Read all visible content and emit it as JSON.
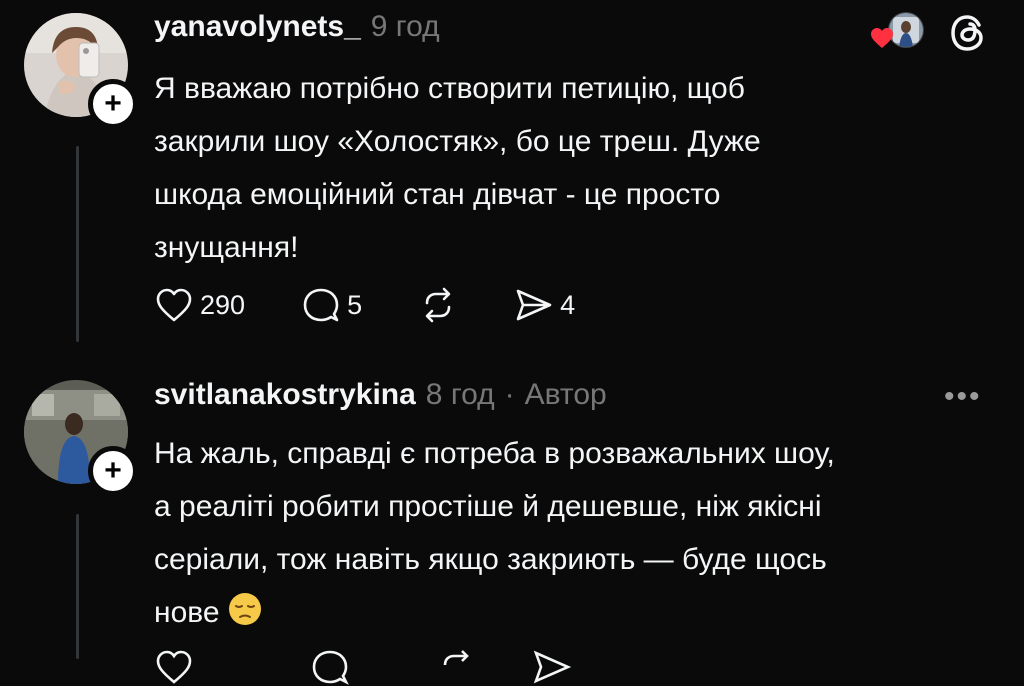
{
  "comments": [
    {
      "username": "yanavolynets_",
      "time": "9 год",
      "lines": [
        "Я вважаю потрібно створити петицію, щоб",
        "закрили шоу «Холостяк», бо це треш. Дуже",
        "шкода емоційний стан дівчат - це просто",
        "знущання!"
      ],
      "likes": "290",
      "replies": "5",
      "shares": "4"
    },
    {
      "username": "svitlanakostrykina",
      "time": "8 год",
      "separator": "·",
      "author_label": "Автор",
      "lines": [
        "На жаль, справді є потреба в розважальних шоу,",
        "а реаліті робити простіше й дешевше, ніж якісні",
        "серіали, тож навіть якщо закриють — буде щось",
        "нове"
      ],
      "emoji": "pensive-face"
    }
  ],
  "colors": {
    "background": "#0a0a0a",
    "text": "#f3f5f7",
    "muted": "#777777",
    "heart": "#ff3040"
  },
  "icons": [
    "heart-icon",
    "comment-icon",
    "repost-icon",
    "share-icon",
    "threads-logo-icon",
    "more-icon",
    "plus-icon"
  ]
}
